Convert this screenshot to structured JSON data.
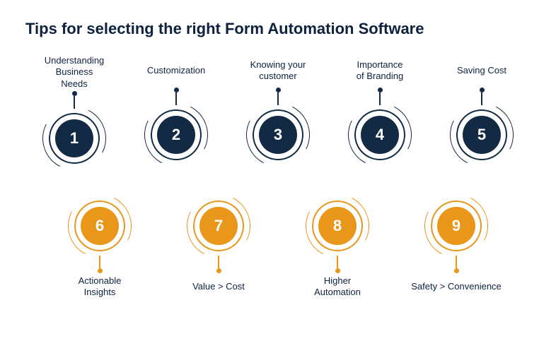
{
  "title": "Tips for selecting the right Form Automation Software",
  "colors": {
    "navy": "#132a45",
    "orange": "#e8971b"
  },
  "tips_top": [
    {
      "number": "1",
      "label": "Understanding\nBusiness\nNeeds"
    },
    {
      "number": "2",
      "label": "Customization"
    },
    {
      "number": "3",
      "label": "Knowing your\ncustomer"
    },
    {
      "number": "4",
      "label": "Importance\nof Branding"
    },
    {
      "number": "5",
      "label": "Saving Cost"
    }
  ],
  "tips_bottom": [
    {
      "number": "6",
      "label": "Actionable\nInsights"
    },
    {
      "number": "7",
      "label": "Value > Cost"
    },
    {
      "number": "8",
      "label": "Higher\nAutomation"
    },
    {
      "number": "9",
      "label": "Safety > Convenience"
    }
  ]
}
